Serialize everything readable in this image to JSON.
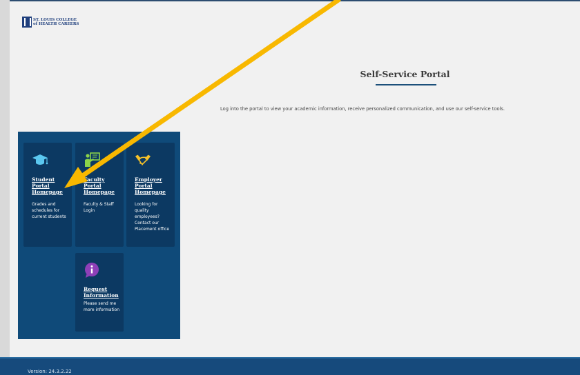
{
  "header": {
    "logo_line1": "ST. LOUIS COLLEGE",
    "logo_line2": "of HEALTH CAREERS"
  },
  "main": {
    "title": "Self-Service Portal",
    "description": "Log into the portal to view your academic information, receive personalized communication, and use our self-service tools."
  },
  "tiles": [
    {
      "heading": "Student Portal Homepage",
      "body": "Grades and schedules for current students",
      "icon": "graduation-cap-icon"
    },
    {
      "heading": "Faculty Portal Homepage",
      "body": "Faculty & Staff Login",
      "icon": "teacher-board-icon"
    },
    {
      "heading": "Employer Portal Homepage",
      "body": "Looking for quality employees? Contact our Placement office",
      "icon": "handshake-icon"
    },
    {
      "heading": "Request Information",
      "body": "Please send me more information",
      "icon": "info-icon"
    }
  ],
  "footer": {
    "version": "Version: 24.3.2.22"
  },
  "colors": {
    "panel": "#0f4a79",
    "tile": "#0c3962",
    "accent_yellow": "#f8b800",
    "footer": "#164a7c"
  }
}
